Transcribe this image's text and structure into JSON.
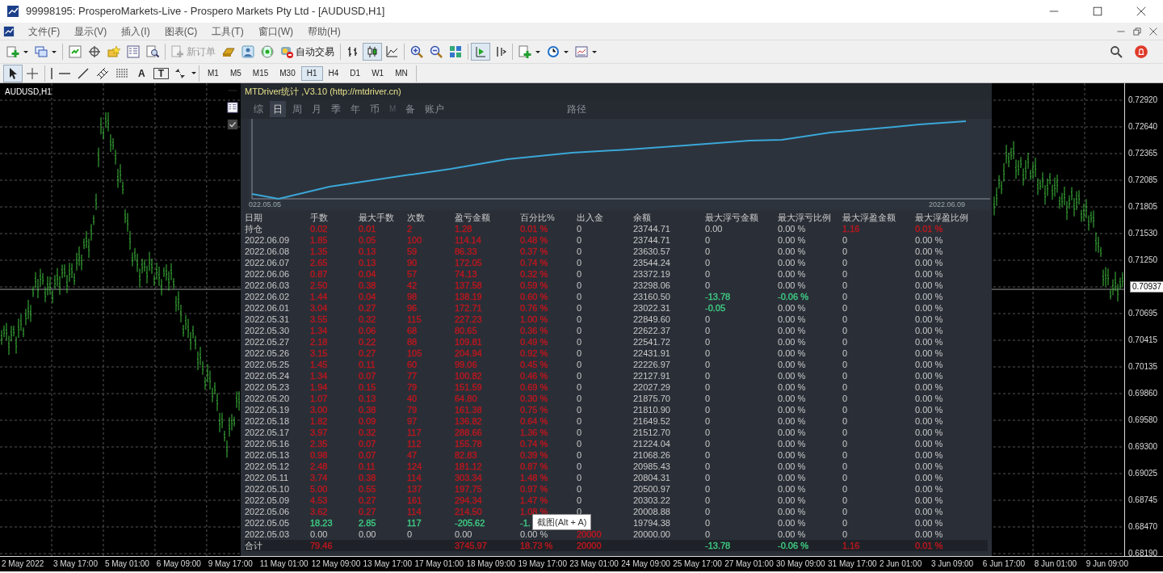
{
  "window": {
    "title": "99998195: ProsperoMarkets-Live - Prospero Markets Pty Ltd - [AUDUSD,H1]"
  },
  "menu": [
    "文件(F)",
    "显示(V)",
    "插入(I)",
    "图表(C)",
    "工具(T)",
    "窗口(W)",
    "帮助(H)"
  ],
  "toolbar": {
    "new_order": {
      "label": "新订单",
      "disabled": true
    },
    "auto_trading": {
      "label": "自动交易",
      "disabled": false
    },
    "chart_types": [
      {
        "kind": "bars",
        "selected": false
      },
      {
        "kind": "candles",
        "selected": true
      },
      {
        "kind": "line",
        "selected": false
      }
    ],
    "scroll": [
      {
        "kind": "autoscroll",
        "selected": true
      },
      {
        "kind": "shift",
        "selected": false
      }
    ]
  },
  "drawing_tools": [
    {
      "kind": "cursor",
      "selected": true
    },
    {
      "kind": "crosshair",
      "selected": false
    },
    {
      "kind": "vline",
      "selected": false
    },
    {
      "kind": "hline",
      "selected": false
    },
    {
      "kind": "trend",
      "selected": false
    },
    {
      "kind": "channel",
      "selected": false
    },
    {
      "kind": "fibo",
      "selected": false
    },
    {
      "kind": "text",
      "label": "A",
      "selected": false
    },
    {
      "kind": "textlabel",
      "label": "T",
      "selected": false
    },
    {
      "kind": "arrows",
      "selected": false
    }
  ],
  "timeframes": [
    {
      "label": "M1",
      "selected": false
    },
    {
      "label": "M5",
      "selected": false
    },
    {
      "label": "M15",
      "selected": false
    },
    {
      "label": "M30",
      "selected": false
    },
    {
      "label": "H1",
      "selected": true
    },
    {
      "label": "H4",
      "selected": false
    },
    {
      "label": "D1",
      "selected": false
    },
    {
      "label": "W1",
      "selected": false
    },
    {
      "label": "MN",
      "selected": false
    }
  ],
  "chart": {
    "symbol": "AUDUSD,H1",
    "price_axis": [
      {
        "kind": "tick",
        "text": "0.72920"
      },
      {
        "kind": "tick",
        "text": "0.72640"
      },
      {
        "kind": "tick",
        "text": "0.72365"
      },
      {
        "kind": "tick",
        "text": "0.72085"
      },
      {
        "kind": "tick",
        "text": "0.71805"
      },
      {
        "kind": "tick",
        "text": "0.71530"
      },
      {
        "kind": "tick",
        "text": "0.71250"
      },
      {
        "kind": "current",
        "text": "0.70937"
      },
      {
        "kind": "tick",
        "text": "0.70695"
      },
      {
        "kind": "tick",
        "text": "0.70415"
      },
      {
        "kind": "tick",
        "text": "0.70135"
      },
      {
        "kind": "tick",
        "text": "0.69860"
      },
      {
        "kind": "tick",
        "text": "0.69580"
      },
      {
        "kind": "tick",
        "text": "0.69300"
      },
      {
        "kind": "tick",
        "text": "0.69025"
      },
      {
        "kind": "tick",
        "text": "0.68745"
      },
      {
        "kind": "tick",
        "text": "0.68470"
      },
      {
        "kind": "tick",
        "text": "0.68190"
      }
    ],
    "time_axis": [
      "2 May 2022",
      "3 May 17:00",
      "5 May 01:00",
      "6 May 09:00",
      "9 May 17:00",
      "11 May 01:00",
      "12 May 09:00",
      "13 May 17:00",
      "17 May 01:00",
      "18 May 09:00",
      "19 May 17:00",
      "23 May 01:00",
      "24 May 09:00",
      "25 May 17:00",
      "27 May 01:00",
      "30 May 09:00",
      "31 May 17:00",
      "2 Jun 01:00",
      "3 Jun 09:00",
      "6 Jun 17:00",
      "8 Jun 01:00",
      "9 Jun 09:00"
    ]
  },
  "panel": {
    "title": "MTDriver统计 ,V3.10 (http://mtdriver.cn)",
    "tabs": [
      {
        "label": "综",
        "selected": false,
        "disabled": false
      },
      {
        "label": "日",
        "selected": true,
        "disabled": false
      },
      {
        "label": "周",
        "selected": false,
        "disabled": false
      },
      {
        "label": "月",
        "selected": false,
        "disabled": false
      },
      {
        "label": "季",
        "selected": false,
        "disabled": false
      },
      {
        "label": "年",
        "selected": false,
        "disabled": false
      },
      {
        "label": "币",
        "selected": false,
        "disabled": false
      },
      {
        "label": "M",
        "selected": false,
        "disabled": true
      },
      {
        "label": "备",
        "selected": false,
        "disabled": false
      },
      {
        "label": "账户",
        "selected": false,
        "disabled": false
      },
      {
        "label": "路径",
        "selected": false,
        "disabled": false
      }
    ],
    "equity": {
      "start_label": "022.05.05",
      "end_label": "2022.06.09"
    },
    "columns": [
      "日期",
      "手数",
      "最大手数",
      "次数",
      "盈亏金额",
      "百分比%",
      "出入金",
      "余额",
      "最大浮亏金额",
      "最大浮亏比例",
      "最大浮盈金额",
      "最大浮盈比例"
    ],
    "rows": [
      {
        "color": "#c0161e",
        "cells": [
          "持仓",
          "0.02",
          "0.01",
          "2",
          "1.28",
          "0.01 %",
          "0",
          "23744.71",
          "0.00",
          "0.00 %",
          {
            "text": "1.16",
            "color": "#c0161e"
          },
          {
            "text": "0.01 %",
            "color": "#c0161e"
          }
        ]
      },
      {
        "color": "#c0161e",
        "cells": [
          "2022.06.09",
          "1.85",
          "0.05",
          "100",
          "114.14",
          "0.48 %",
          "0",
          "23744.71",
          "0",
          "0.00 %",
          "0",
          "0.00 %"
        ]
      },
      {
        "color": "#c0161e",
        "cells": [
          "2022.06.08",
          "1.35",
          "0.13",
          "59",
          "86.33",
          "0.37 %",
          "0",
          "23630.57",
          "0",
          "0.00 %",
          "0",
          "0.00 %"
        ]
      },
      {
        "color": "#c0161e",
        "cells": [
          "2022.06.07",
          "2.65",
          "0.13",
          "90",
          "172.05",
          "0.74 %",
          "0",
          "23544.24",
          "0",
          "0.00 %",
          "0",
          "0.00 %"
        ]
      },
      {
        "color": "#c0161e",
        "cells": [
          "2022.06.06",
          "0.87",
          "0.04",
          "57",
          "74.13",
          "0.32 %",
          "0",
          "23372.19",
          "0",
          "0.00 %",
          "0",
          "0.00 %"
        ]
      },
      {
        "color": "#c0161e",
        "cells": [
          "2022.06.03",
          "2.50",
          "0.38",
          "42",
          "137.58",
          "0.59 %",
          "0",
          "23298.06",
          "0",
          "0.00 %",
          "0",
          "0.00 %"
        ]
      },
      {
        "color": "#c0161e",
        "cells": [
          "2022.06.02",
          "1.44",
          "0.04",
          "98",
          "138.19",
          "0.60 %",
          "0",
          "23160.50",
          {
            "text": "-13.78",
            "color": "#3fcf86"
          },
          {
            "text": "-0.06 %",
            "color": "#3fcf86"
          },
          "0",
          "0.00 %"
        ]
      },
      {
        "color": "#c0161e",
        "cells": [
          "2022.06.01",
          "3.04",
          "0.27",
          "96",
          "172.71",
          "0.76 %",
          "0",
          "23022.31",
          {
            "text": "-0.05",
            "color": "#3fcf86"
          },
          "0.00 %",
          "0",
          "0.00 %"
        ]
      },
      {
        "color": "#c0161e",
        "cells": [
          "2022.05.31",
          "3.55",
          "0.32",
          "115",
          "227.23",
          "1.00 %",
          "0",
          "22849.60",
          "0",
          "0.00 %",
          "0",
          "0.00 %"
        ]
      },
      {
        "color": "#c0161e",
        "cells": [
          "2022.05.30",
          "1.34",
          "0.06",
          "68",
          "80.65",
          "0.36 %",
          "0",
          "22622.37",
          "0",
          "0.00 %",
          "0",
          "0.00 %"
        ]
      },
      {
        "color": "#c0161e",
        "cells": [
          "2022.05.27",
          "2.18",
          "0.22",
          "88",
          "109.81",
          "0.49 %",
          "0",
          "22541.72",
          "0",
          "0.00 %",
          "0",
          "0.00 %"
        ]
      },
      {
        "color": "#c0161e",
        "cells": [
          "2022.05.26",
          "3.15",
          "0.27",
          "105",
          "204.94",
          "0.92 %",
          "0",
          "22431.91",
          "0",
          "0.00 %",
          "0",
          "0.00 %"
        ]
      },
      {
        "color": "#c0161e",
        "cells": [
          "2022.05.25",
          "1.45",
          "0.11",
          "60",
          "99.06",
          "0.45 %",
          "0",
          "22226.97",
          "0",
          "0.00 %",
          "0",
          "0.00 %"
        ]
      },
      {
        "color": "#c0161e",
        "cells": [
          "2022.05.24",
          "1.34",
          "0.07",
          "77",
          "100.82",
          "0.46 %",
          "0",
          "22127.91",
          "0",
          "0.00 %",
          "0",
          "0.00 %"
        ]
      },
      {
        "color": "#c0161e",
        "cells": [
          "2022.05.23",
          "1.94",
          "0.15",
          "79",
          "151.59",
          "0.69 %",
          "0",
          "22027.29",
          "0",
          "0.00 %",
          "0",
          "0.00 %"
        ]
      },
      {
        "color": "#c0161e",
        "cells": [
          "2022.05.20",
          "1.07",
          "0.13",
          "40",
          "64.80",
          "0.30 %",
          "0",
          "21875.70",
          "0",
          "0.00 %",
          "0",
          "0.00 %"
        ]
      },
      {
        "color": "#c0161e",
        "cells": [
          "2022.05.19",
          "3.00",
          "0.38",
          "79",
          "161.38",
          "0.75 %",
          "0",
          "21810.90",
          "0",
          "0.00 %",
          "0",
          "0.00 %"
        ]
      },
      {
        "color": "#c0161e",
        "cells": [
          "2022.05.18",
          "1.82",
          "0.09",
          "97",
          "136.82",
          "0.64 %",
          "0",
          "21649.52",
          "0",
          "0.00 %",
          "0",
          "0.00 %"
        ]
      },
      {
        "color": "#c0161e",
        "cells": [
          "2022.05.17",
          "3.97",
          "0.32",
          "117",
          "288.66",
          "1.36 %",
          "0",
          "21512.70",
          "0",
          "0.00 %",
          "0",
          "0.00 %"
        ]
      },
      {
        "color": "#c0161e",
        "cells": [
          "2022.05.16",
          "2.35",
          "0.07",
          "112",
          "155.78",
          "0.74 %",
          "0",
          "21224.04",
          "0",
          "0.00 %",
          "0",
          "0.00 %"
        ]
      },
      {
        "color": "#c0161e",
        "cells": [
          "2022.05.13",
          "0.98",
          "0.07",
          "47",
          "82.83",
          "0.39 %",
          "0",
          "21068.26",
          "0",
          "0.00 %",
          "0",
          "0.00 %"
        ]
      },
      {
        "color": "#c0161e",
        "cells": [
          "2022.05.12",
          "2.48",
          "0.11",
          "124",
          "181.12",
          "0.87 %",
          "0",
          "20985.43",
          "0",
          "0.00 %",
          "0",
          "0.00 %"
        ]
      },
      {
        "color": "#c0161e",
        "cells": [
          "2022.05.11",
          "3.74",
          "0.38",
          "114",
          "303.34",
          "1.48 %",
          "0",
          "20804.31",
          "0",
          "0.00 %",
          "0",
          "0.00 %"
        ]
      },
      {
        "color": "#c0161e",
        "cells": [
          "2022.05.10",
          "5.00",
          "0.55",
          "137",
          "197.75",
          "0.97 %",
          "0",
          "20500.97",
          "0",
          "0.00 %",
          "0",
          "0.00 %"
        ]
      },
      {
        "color": "#c0161e",
        "cells": [
          "2022.05.09",
          "4.53",
          "0.27",
          "161",
          "294.34",
          "1.47 %",
          "0",
          "20303.22",
          "0",
          "0.00 %",
          "0",
          "0.00 %"
        ]
      },
      {
        "color": "#c0161e",
        "cells": [
          "2022.05.06",
          "3.62",
          "0.27",
          "114",
          "214.50",
          "1.08 %",
          "0",
          "20008.88",
          "0",
          "0.00 %",
          "0",
          "0.00 %"
        ]
      },
      {
        "color": "#3fcf86",
        "tooltip": "截图(Alt + A)",
        "cells": [
          "2022.05.05",
          "18.23",
          "2.85",
          "117",
          "-205.62",
          "-1.",
          null,
          "19794.38",
          "0",
          "0.00 %",
          "0",
          "0.00 %"
        ]
      },
      {
        "cells": [
          "2022.05.03",
          "0.00",
          "0.00",
          "0",
          "0.00",
          "0.00 %",
          {
            "text": "20000",
            "color": "#c0161e"
          },
          "20000.00",
          "0",
          "0.00 %",
          "0",
          "0.00 %"
        ]
      }
    ],
    "total": {
      "color": "#c0161e",
      "cells": [
        "合计",
        "79.46",
        null,
        null,
        "3745.97",
        "18.73 %",
        {
          "text": "20000",
          "color": "#c0161e"
        },
        null,
        {
          "text": "-13.78",
          "color": "#3fcf86"
        },
        {
          "text": "-0.06 %",
          "color": "#3fcf86"
        },
        {
          "text": "1.16",
          "color": "#c0161e"
        },
        {
          "text": "0.01 %",
          "color": "#c0161e"
        }
      ]
    }
  }
}
